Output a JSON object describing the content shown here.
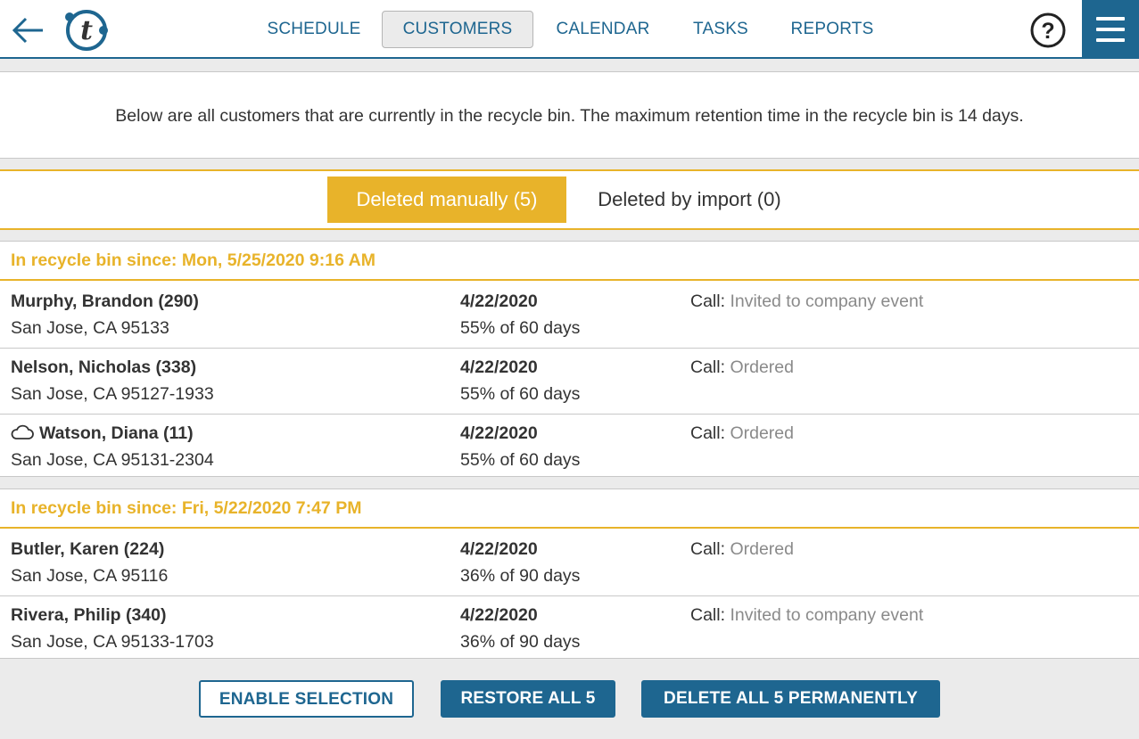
{
  "header": {
    "back_icon": "arrow-left-icon",
    "logo_letter": "t",
    "nav": [
      {
        "label": "SCHEDULE",
        "active": false
      },
      {
        "label": "CUSTOMERS",
        "active": true
      },
      {
        "label": "CALENDAR",
        "active": false
      },
      {
        "label": "TASKS",
        "active": false
      },
      {
        "label": "REPORTS",
        "active": false
      }
    ],
    "help_label": "?",
    "menu_icon": "hamburger-icon"
  },
  "info": {
    "text": "Below are all customers that are currently in the recycle bin. The maximum retention time in the recycle bin is 14 days."
  },
  "tabs": [
    {
      "label": "Deleted manually (5)",
      "active": true
    },
    {
      "label": "Deleted by import (0)",
      "active": false
    }
  ],
  "groups": [
    {
      "title": "In recycle bin since: Mon, 5/25/2020 9:16 AM",
      "rows": [
        {
          "name": "Murphy, Brandon (290)",
          "address": "San Jose, CA 95133",
          "date": "4/22/2020",
          "progress": "55% of 60 days",
          "call_label": "Call:",
          "call_value": "Invited to company event",
          "cloud": false
        },
        {
          "name": "Nelson, Nicholas (338)",
          "address": "San Jose, CA 95127-1933",
          "date": "4/22/2020",
          "progress": "55% of 60 days",
          "call_label": "Call:",
          "call_value": "Ordered",
          "cloud": false
        },
        {
          "name": "Watson, Diana (11)",
          "address": "San Jose, CA 95131-2304",
          "date": "4/22/2020",
          "progress": "55% of 60 days",
          "call_label": "Call:",
          "call_value": "Ordered",
          "cloud": true
        }
      ]
    },
    {
      "title": "In recycle bin since: Fri, 5/22/2020 7:47 PM",
      "rows": [
        {
          "name": "Butler, Karen (224)",
          "address": "San Jose, CA 95116",
          "date": "4/22/2020",
          "progress": "36% of 90 days",
          "call_label": "Call:",
          "call_value": "Ordered",
          "cloud": false
        },
        {
          "name": "Rivera, Philip (340)",
          "address": "San Jose, CA 95133-1703",
          "date": "4/22/2020",
          "progress": "36% of 90 days",
          "call_label": "Call:",
          "call_value": "Invited to company event",
          "cloud": false
        }
      ]
    }
  ],
  "footer": {
    "enable_selection": "ENABLE SELECTION",
    "restore_all": "RESTORE ALL 5",
    "delete_all": "DELETE ALL 5 PERMANENTLY"
  },
  "colors": {
    "brand_blue": "#1e6690",
    "accent_yellow": "#e8b32a",
    "muted_text": "#8a8a8a",
    "background_gray": "#ebebeb"
  }
}
